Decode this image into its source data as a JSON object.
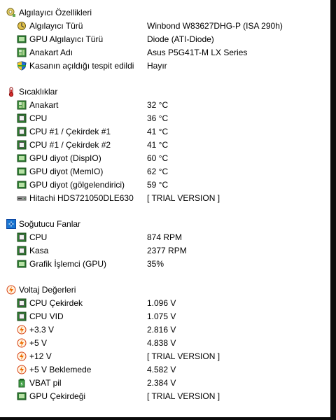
{
  "sections": {
    "sensor_props": {
      "title": "Algılayıcı Özellikleri",
      "rows": [
        {
          "label": "Algılayıcı Türü",
          "value": "Winbond W83627DHG-P  (ISA 290h)"
        },
        {
          "label": "GPU Algılayıcı Türü",
          "value": "Diode  (ATI-Diode)"
        },
        {
          "label": "Anakart Adı",
          "value": "Asus P5G41T-M LX Series"
        },
        {
          "label": "Kasanın açıldığı tespit edildi",
          "value": "Hayır"
        }
      ]
    },
    "temperatures": {
      "title": "Sıcaklıklar",
      "rows": [
        {
          "label": "Anakart",
          "value": "32 °C"
        },
        {
          "label": "CPU",
          "value": "36 °C"
        },
        {
          "label": "CPU #1 / Çekirdek #1",
          "value": "41 °C"
        },
        {
          "label": "CPU #1 / Çekirdek #2",
          "value": "41 °C"
        },
        {
          "label": "GPU diyot (DispIO)",
          "value": "60 °C"
        },
        {
          "label": "GPU diyot (MemIO)",
          "value": "62 °C"
        },
        {
          "label": "GPU diyot (gölgelendirici)",
          "value": "59 °C"
        },
        {
          "label": "Hitachi HDS721050DLE630",
          "value": "[ TRIAL VERSION ]"
        }
      ]
    },
    "fans": {
      "title": "Soğutucu Fanlar",
      "rows": [
        {
          "label": "CPU",
          "value": "874 RPM"
        },
        {
          "label": "Kasa",
          "value": "2377 RPM"
        },
        {
          "label": "Grafik İşlemci (GPU)",
          "value": "35%"
        }
      ]
    },
    "voltages": {
      "title": "Voltaj Değerleri",
      "rows": [
        {
          "label": "CPU Çekirdek",
          "value": "1.096 V"
        },
        {
          "label": "CPU VID",
          "value": "1.075 V"
        },
        {
          "label": "+3.3 V",
          "value": "2.816 V"
        },
        {
          "label": "+5 V",
          "value": "4.838 V"
        },
        {
          "label": "+12 V",
          "value": "[ TRIAL VERSION ]"
        },
        {
          "label": "+5 V Beklemede",
          "value": "4.582 V"
        },
        {
          "label": "VBAT pil",
          "value": "2.384 V"
        },
        {
          "label": "GPU Çekirdeği",
          "value": "[ TRIAL VERSION ]"
        }
      ]
    }
  }
}
